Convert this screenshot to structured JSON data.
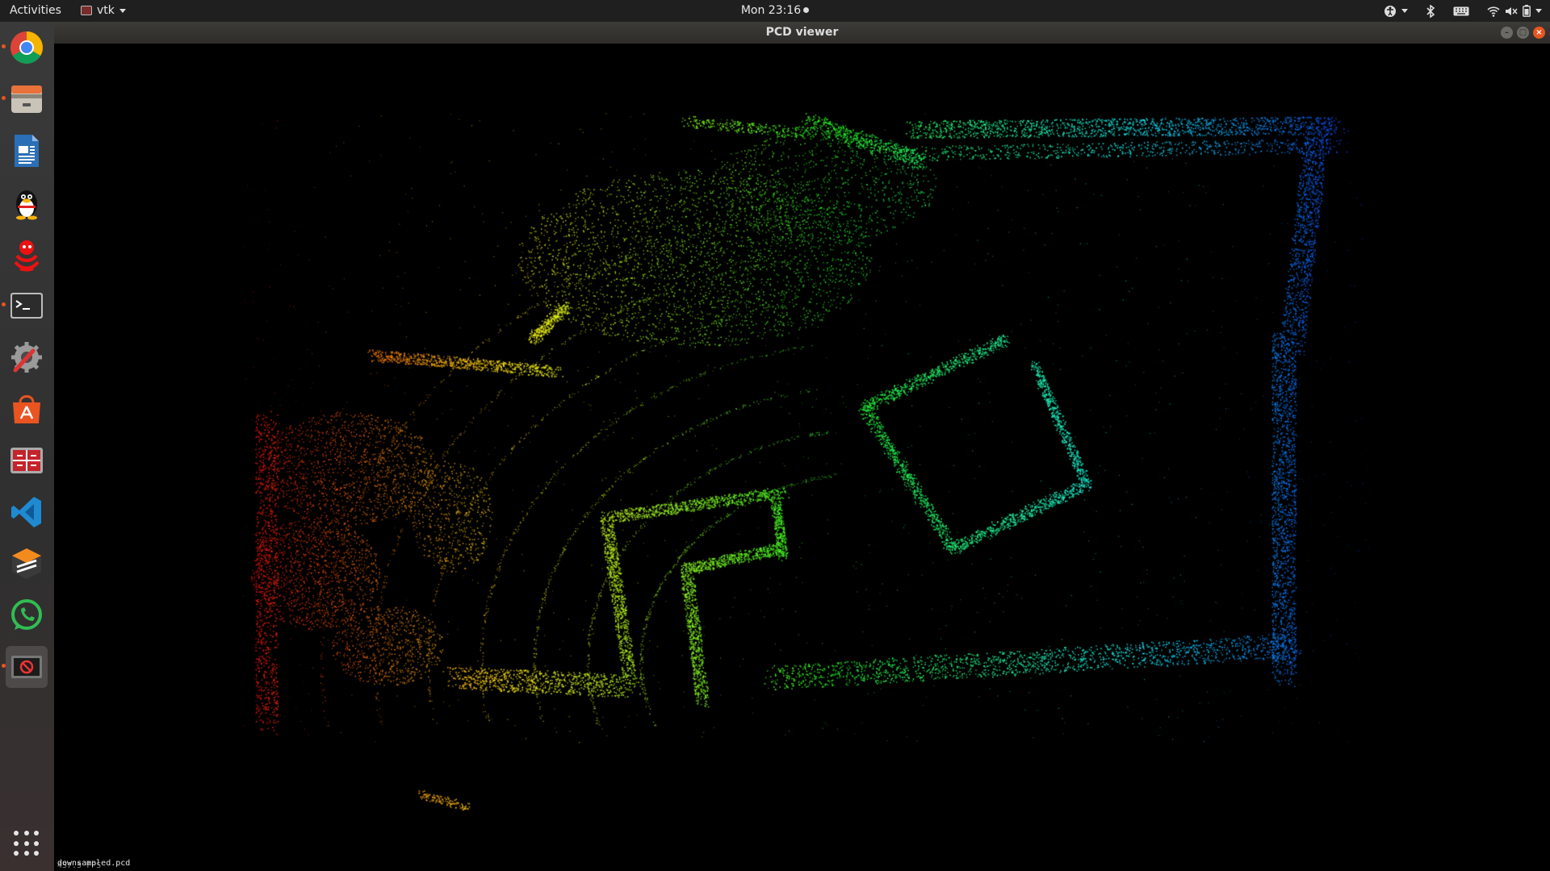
{
  "topbar": {
    "activities": "Activities",
    "app_name": "vtk",
    "clock": "Mon 23:16"
  },
  "dock": {
    "items": [
      {
        "name": "chrome",
        "running": true
      },
      {
        "name": "files",
        "running": true
      },
      {
        "name": "writer",
        "running": false
      },
      {
        "name": "qq",
        "running": false
      },
      {
        "name": "red-app",
        "running": false
      },
      {
        "name": "terminal",
        "running": true
      },
      {
        "name": "settings-tool",
        "running": false
      },
      {
        "name": "software-center",
        "running": false
      },
      {
        "name": "app-red-window",
        "running": false
      },
      {
        "name": "vscode",
        "running": false
      },
      {
        "name": "sublime",
        "running": false
      },
      {
        "name": "whatsapp",
        "running": false
      },
      {
        "name": "vtk-app",
        "running": true,
        "active": true
      }
    ]
  },
  "window": {
    "title": "PCD viewer",
    "status_text": "downsampled.pcd",
    "fps_text": "457.5 FPS"
  },
  "colors": {
    "ubuntu_orange": "#e95420",
    "background": "#000000"
  }
}
